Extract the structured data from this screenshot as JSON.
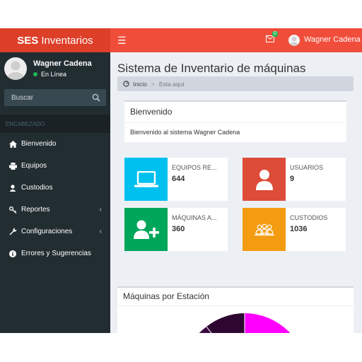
{
  "header": {
    "brand_bold": "SES",
    "brand_rest": "Inventarios",
    "menu_icon": "hamburger-icon",
    "mail_badge": "0",
    "user_name": "Wagner Cadena"
  },
  "sidebar": {
    "user_name": "Wagner Cadena",
    "status": "En Línea",
    "search_placeholder": "Buscar",
    "section_header": "ENCABEZADO",
    "items": [
      {
        "label": "Bienvenido",
        "icon": "home-icon"
      },
      {
        "label": "Equipos",
        "icon": "printer-icon"
      },
      {
        "label": "Custodios",
        "icon": "user-icon"
      },
      {
        "label": "Reportes",
        "icon": "key-icon"
      },
      {
        "label": "Configuraciones",
        "icon": "wrench-icon"
      },
      {
        "label": "Errores y Sugerencias",
        "icon": "info-icon"
      }
    ]
  },
  "content": {
    "page_title": "Sistema de Inventario de máquinas",
    "breadcrumb": {
      "home": "Inicio",
      "current": "Esta aquí"
    },
    "welcome_box": {
      "title": "Bienvenido",
      "body": "Bienvenido al sistema Wagner Cadena"
    },
    "info_boxes": [
      {
        "label": "EQUIPOS RE...",
        "value": "644",
        "color": "#00c0ef",
        "icon": "laptop-icon"
      },
      {
        "label": "USUARIOS",
        "value": "9",
        "color": "#dd4b39",
        "icon": "user-icon"
      },
      {
        "label": "MÁQUINAS A...",
        "value": "360",
        "color": "#00a65a",
        "icon": "user-add-icon"
      },
      {
        "label": "CUSTODIOS",
        "value": "1036",
        "color": "#f39c12",
        "icon": "group-icon"
      }
    ],
    "chart_title": "Máquinas por Estación"
  },
  "colors": {
    "header_logo": "#dd3f28",
    "header_bar": "#f04d3a",
    "sidebar": "#222d32",
    "content_bg": "#ecf0f5"
  }
}
